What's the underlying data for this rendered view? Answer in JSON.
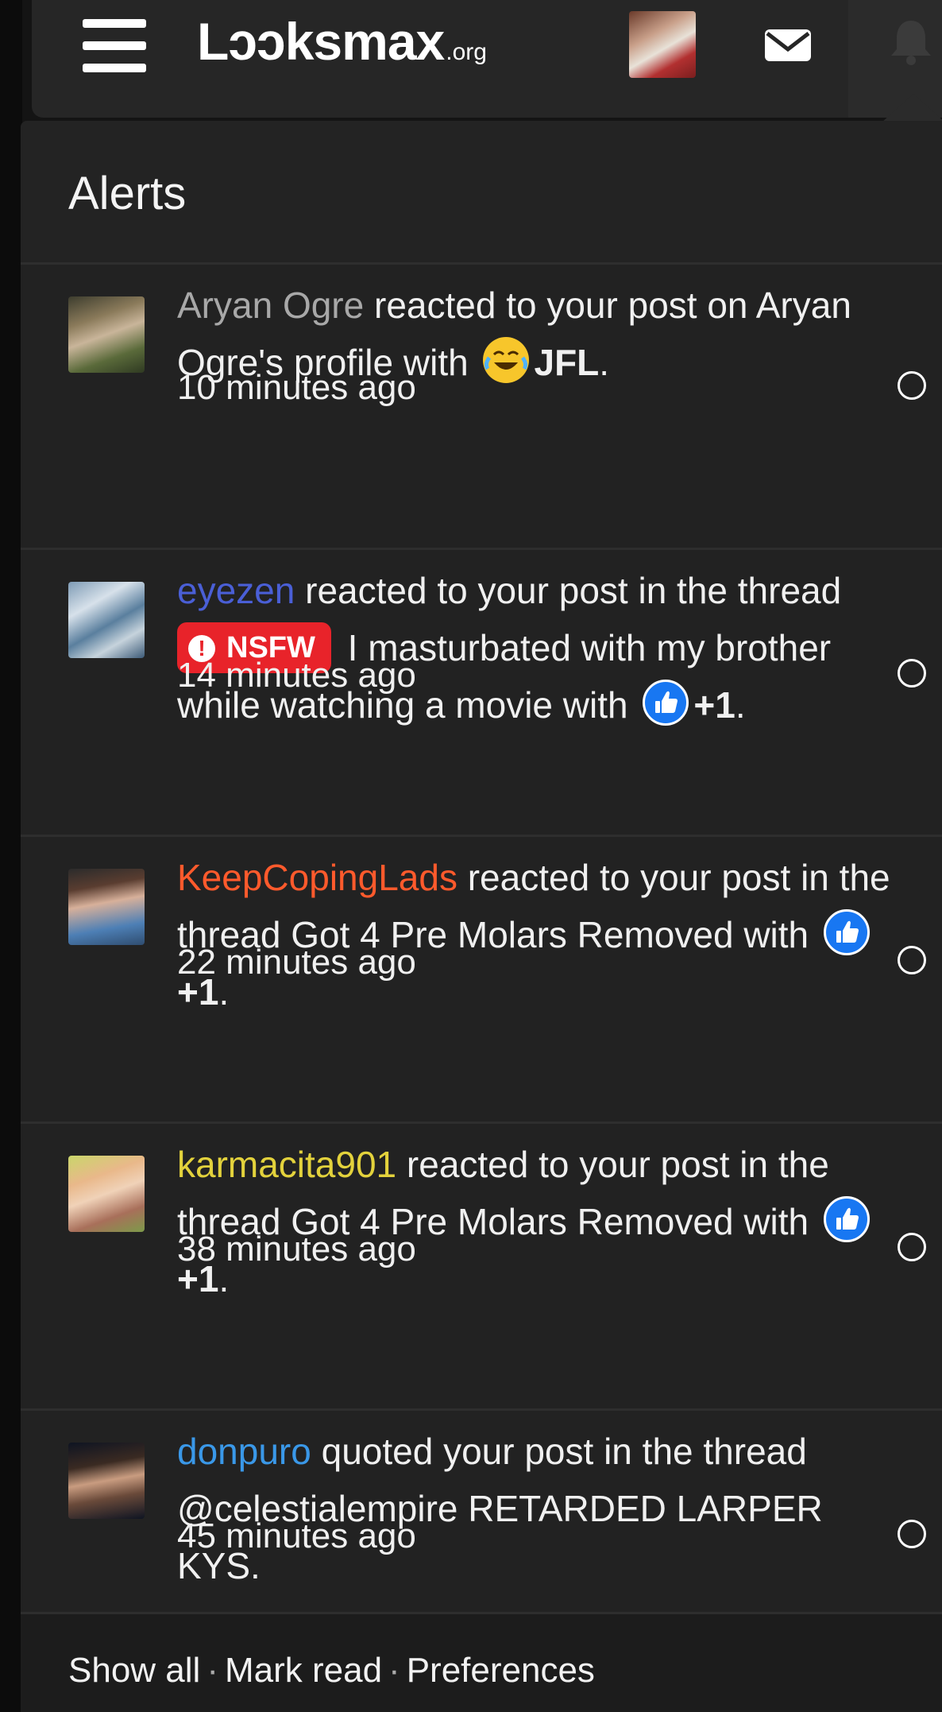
{
  "header": {
    "logo_main": "Lↄↄksmax",
    "logo_tld": ".org"
  },
  "panel": {
    "title": "Alerts"
  },
  "colors": {
    "user_grey": "#a8a8a8",
    "user_blue": "#4a5fd6",
    "user_orange": "#ff5a2c",
    "user_yellow": "#e3d23c",
    "user_lightblue": "#3a98e8",
    "nsfw_badge": "#e8232a",
    "like_blue": "#1877f2"
  },
  "alerts": [
    {
      "user": "Aryan Ogre",
      "text_1": " reacted to your post on Aryan Ogre's profile with ",
      "reaction_icon": "laughing-crying-emoji",
      "reaction": "JFL",
      "end": ".",
      "time": "10 minutes ago"
    },
    {
      "user": "eyezen",
      "text_1": " reacted to your post in the thread ",
      "badge": "NSFW",
      "thread": " I masturbated with my brother while watching a movie",
      "text_2": " with ",
      "reaction_icon": "thumbs-up-emoji",
      "reaction": "+1",
      "end": ".",
      "time": "14 minutes ago"
    },
    {
      "user": "KeepCopingLads",
      "text_1": " reacted to your post in the thread ",
      "thread": "Got 4 Pre Molars Removed",
      "text_2": " with ",
      "reaction_icon": "thumbs-up-emoji",
      "reaction": "+1",
      "end": ".",
      "time": "22 minutes ago"
    },
    {
      "user": "karmacita901",
      "text_1": " reacted to your post in the thread ",
      "thread": "Got 4 Pre Molars Removed",
      "text_2": " with ",
      "reaction_icon": "thumbs-up-emoji",
      "reaction": "+1",
      "end": ".",
      "time": "38 minutes ago"
    },
    {
      "user": "donpuro",
      "text_1": " quoted your post in the thread ",
      "thread": "@celestialempire RETARDED LARPER KYS",
      "end": ".",
      "time": "45 minutes ago"
    }
  ],
  "footer": {
    "show_all": "Show all",
    "separator": "·",
    "mark_read": "Mark read",
    "preferences": "Preferences"
  }
}
